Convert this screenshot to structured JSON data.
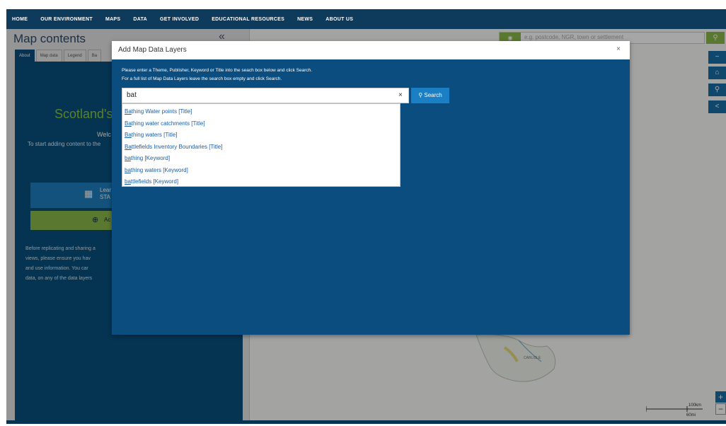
{
  "topnav": {
    "items": [
      "HOME",
      "OUR ENVIRONMENT",
      "MAPS",
      "DATA",
      "GET INVOLVED",
      "EDUCATIONAL RESOURCES",
      "NEWS",
      "ABOUT US"
    ]
  },
  "sidebar": {
    "title": "Map contents",
    "collapse": "«",
    "tabs": [
      "About",
      "Map data",
      "Legend",
      "Ba"
    ],
    "heading": "Scotland's",
    "welcome": "Welc",
    "intro": "To start adding content to the",
    "learn_icon": "map-icon",
    "learn_line1": "Lear",
    "learn_line2": "STA",
    "add_icon": "plus-circle-icon",
    "add_label": "Ac",
    "paragraph_lines": [
      "Before replicating and sharing a",
      "views, please ensure you hav",
      "and use information. You car",
      "data, on any of the data layers"
    ]
  },
  "map": {
    "search_placeholder": "e.g. postcode, NGR, town or settlement",
    "search_icon": "search-icon",
    "controls": [
      "−",
      "⌂",
      "⚲",
      "share"
    ],
    "zoom_in": "+",
    "zoom_out": "−",
    "scale_km": "100km",
    "scale_mi": "60mi"
  },
  "modal": {
    "title": "Add Map Data Layers",
    "close": "×",
    "instruction1": "Please enter a Theme, Publisher, Keyword or Title into the seach box below and click Search.",
    "instruction2": "For a full list of Map Data Layers leave the search box empty and click Search.",
    "search_value": "bat",
    "clear": "×",
    "search_button": "Search",
    "suggestions": [
      {
        "match": "Ba",
        "rest": "thing Water points [Title]"
      },
      {
        "match": "Ba",
        "rest": "thing water catchments [Title]"
      },
      {
        "match": "Ba",
        "rest": "thing waters [Title]"
      },
      {
        "match": "Ba",
        "rest": "ttlefields Inventory Boundaries [Title]"
      },
      {
        "match": "ba",
        "rest": "thing [Keyword]"
      },
      {
        "match": "ba",
        "rest": "thing waters [Keyword]"
      },
      {
        "match": "ba",
        "rest": "ttlefields [Keyword]"
      }
    ]
  }
}
